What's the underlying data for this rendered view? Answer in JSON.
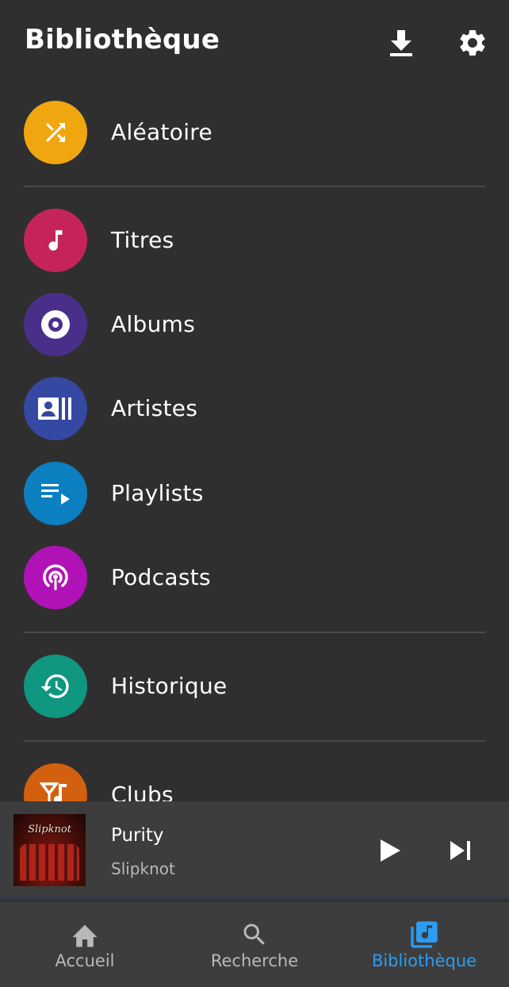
{
  "header": {
    "title": "Bibliothèque",
    "download_icon": "download-icon",
    "settings_icon": "gear-icon"
  },
  "library": {
    "items": [
      {
        "label": "Aléatoire",
        "icon": "shuffle-icon",
        "color": "#f0a70f"
      },
      {
        "label": "Titres",
        "icon": "music-note-icon",
        "color": "#c4245a"
      },
      {
        "label": "Albums",
        "icon": "disc-icon",
        "color": "#4a2f8a"
      },
      {
        "label": "Artistes",
        "icon": "artist-card-icon",
        "color": "#3549a2"
      },
      {
        "label": "Playlists",
        "icon": "playlist-icon",
        "color": "#0b7fbf"
      },
      {
        "label": "Podcasts",
        "icon": "podcast-icon",
        "color": "#b012b5"
      },
      {
        "label": "Historique",
        "icon": "history-icon",
        "color": "#0f9780"
      },
      {
        "label": "Clubs",
        "icon": "clubs-icon",
        "color": "#d2600e"
      }
    ]
  },
  "player": {
    "song": "Purity",
    "artist": "Slipknot",
    "cover_text": "Slipknot",
    "play_icon": "play-icon",
    "next_icon": "skip-next-icon"
  },
  "nav": {
    "items": [
      {
        "label": "Accueil",
        "icon": "home-icon"
      },
      {
        "label": "Recherche",
        "icon": "search-icon"
      },
      {
        "label": "Bibliothèque",
        "icon": "library-music-icon"
      }
    ],
    "active_color": "#2a9df4"
  }
}
